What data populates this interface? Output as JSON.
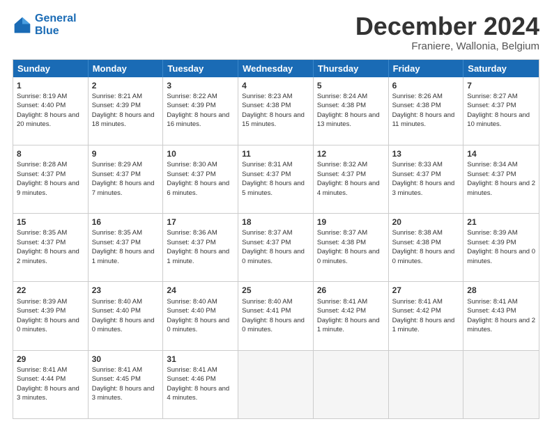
{
  "logo": {
    "line1": "General",
    "line2": "Blue"
  },
  "title": "December 2024",
  "location": "Franiere, Wallonia, Belgium",
  "days_header": [
    "Sunday",
    "Monday",
    "Tuesday",
    "Wednesday",
    "Thursday",
    "Friday",
    "Saturday"
  ],
  "weeks": [
    [
      {
        "day": "1",
        "sunrise": "Sunrise: 8:19 AM",
        "sunset": "Sunset: 4:40 PM",
        "daylight": "Daylight: 8 hours and 20 minutes."
      },
      {
        "day": "2",
        "sunrise": "Sunrise: 8:21 AM",
        "sunset": "Sunset: 4:39 PM",
        "daylight": "Daylight: 8 hours and 18 minutes."
      },
      {
        "day": "3",
        "sunrise": "Sunrise: 8:22 AM",
        "sunset": "Sunset: 4:39 PM",
        "daylight": "Daylight: 8 hours and 16 minutes."
      },
      {
        "day": "4",
        "sunrise": "Sunrise: 8:23 AM",
        "sunset": "Sunset: 4:38 PM",
        "daylight": "Daylight: 8 hours and 15 minutes."
      },
      {
        "day": "5",
        "sunrise": "Sunrise: 8:24 AM",
        "sunset": "Sunset: 4:38 PM",
        "daylight": "Daylight: 8 hours and 13 minutes."
      },
      {
        "day": "6",
        "sunrise": "Sunrise: 8:26 AM",
        "sunset": "Sunset: 4:38 PM",
        "daylight": "Daylight: 8 hours and 11 minutes."
      },
      {
        "day": "7",
        "sunrise": "Sunrise: 8:27 AM",
        "sunset": "Sunset: 4:37 PM",
        "daylight": "Daylight: 8 hours and 10 minutes."
      }
    ],
    [
      {
        "day": "8",
        "sunrise": "Sunrise: 8:28 AM",
        "sunset": "Sunset: 4:37 PM",
        "daylight": "Daylight: 8 hours and 9 minutes."
      },
      {
        "day": "9",
        "sunrise": "Sunrise: 8:29 AM",
        "sunset": "Sunset: 4:37 PM",
        "daylight": "Daylight: 8 hours and 7 minutes."
      },
      {
        "day": "10",
        "sunrise": "Sunrise: 8:30 AM",
        "sunset": "Sunset: 4:37 PM",
        "daylight": "Daylight: 8 hours and 6 minutes."
      },
      {
        "day": "11",
        "sunrise": "Sunrise: 8:31 AM",
        "sunset": "Sunset: 4:37 PM",
        "daylight": "Daylight: 8 hours and 5 minutes."
      },
      {
        "day": "12",
        "sunrise": "Sunrise: 8:32 AM",
        "sunset": "Sunset: 4:37 PM",
        "daylight": "Daylight: 8 hours and 4 minutes."
      },
      {
        "day": "13",
        "sunrise": "Sunrise: 8:33 AM",
        "sunset": "Sunset: 4:37 PM",
        "daylight": "Daylight: 8 hours and 3 minutes."
      },
      {
        "day": "14",
        "sunrise": "Sunrise: 8:34 AM",
        "sunset": "Sunset: 4:37 PM",
        "daylight": "Daylight: 8 hours and 2 minutes."
      }
    ],
    [
      {
        "day": "15",
        "sunrise": "Sunrise: 8:35 AM",
        "sunset": "Sunset: 4:37 PM",
        "daylight": "Daylight: 8 hours and 2 minutes."
      },
      {
        "day": "16",
        "sunrise": "Sunrise: 8:35 AM",
        "sunset": "Sunset: 4:37 PM",
        "daylight": "Daylight: 8 hours and 1 minute."
      },
      {
        "day": "17",
        "sunrise": "Sunrise: 8:36 AM",
        "sunset": "Sunset: 4:37 PM",
        "daylight": "Daylight: 8 hours and 1 minute."
      },
      {
        "day": "18",
        "sunrise": "Sunrise: 8:37 AM",
        "sunset": "Sunset: 4:37 PM",
        "daylight": "Daylight: 8 hours and 0 minutes."
      },
      {
        "day": "19",
        "sunrise": "Sunrise: 8:37 AM",
        "sunset": "Sunset: 4:38 PM",
        "daylight": "Daylight: 8 hours and 0 minutes."
      },
      {
        "day": "20",
        "sunrise": "Sunrise: 8:38 AM",
        "sunset": "Sunset: 4:38 PM",
        "daylight": "Daylight: 8 hours and 0 minutes."
      },
      {
        "day": "21",
        "sunrise": "Sunrise: 8:39 AM",
        "sunset": "Sunset: 4:39 PM",
        "daylight": "Daylight: 8 hours and 0 minutes."
      }
    ],
    [
      {
        "day": "22",
        "sunrise": "Sunrise: 8:39 AM",
        "sunset": "Sunset: 4:39 PM",
        "daylight": "Daylight: 8 hours and 0 minutes."
      },
      {
        "day": "23",
        "sunrise": "Sunrise: 8:40 AM",
        "sunset": "Sunset: 4:40 PM",
        "daylight": "Daylight: 8 hours and 0 minutes."
      },
      {
        "day": "24",
        "sunrise": "Sunrise: 8:40 AM",
        "sunset": "Sunset: 4:40 PM",
        "daylight": "Daylight: 8 hours and 0 minutes."
      },
      {
        "day": "25",
        "sunrise": "Sunrise: 8:40 AM",
        "sunset": "Sunset: 4:41 PM",
        "daylight": "Daylight: 8 hours and 0 minutes."
      },
      {
        "day": "26",
        "sunrise": "Sunrise: 8:41 AM",
        "sunset": "Sunset: 4:42 PM",
        "daylight": "Daylight: 8 hours and 1 minute."
      },
      {
        "day": "27",
        "sunrise": "Sunrise: 8:41 AM",
        "sunset": "Sunset: 4:42 PM",
        "daylight": "Daylight: 8 hours and 1 minute."
      },
      {
        "day": "28",
        "sunrise": "Sunrise: 8:41 AM",
        "sunset": "Sunset: 4:43 PM",
        "daylight": "Daylight: 8 hours and 2 minutes."
      }
    ],
    [
      {
        "day": "29",
        "sunrise": "Sunrise: 8:41 AM",
        "sunset": "Sunset: 4:44 PM",
        "daylight": "Daylight: 8 hours and 3 minutes."
      },
      {
        "day": "30",
        "sunrise": "Sunrise: 8:41 AM",
        "sunset": "Sunset: 4:45 PM",
        "daylight": "Daylight: 8 hours and 3 minutes."
      },
      {
        "day": "31",
        "sunrise": "Sunrise: 8:41 AM",
        "sunset": "Sunset: 4:46 PM",
        "daylight": "Daylight: 8 hours and 4 minutes."
      },
      null,
      null,
      null,
      null
    ]
  ]
}
